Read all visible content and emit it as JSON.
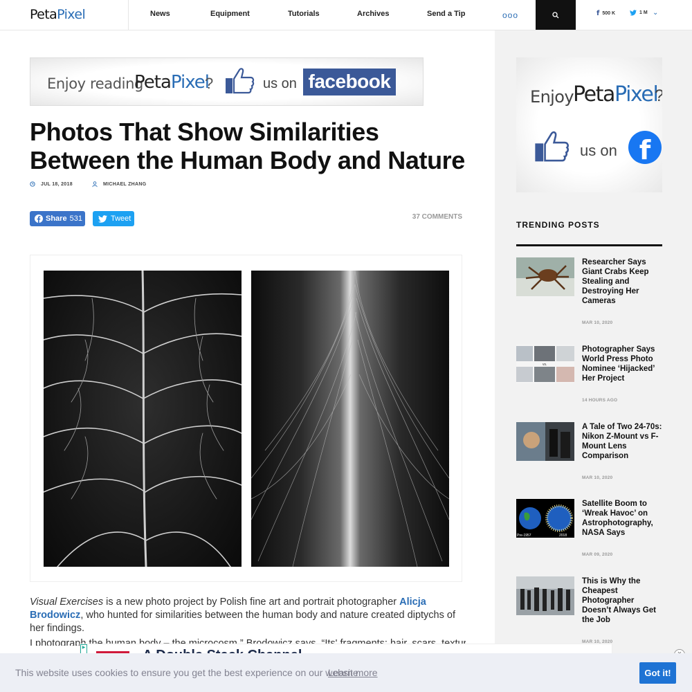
{
  "header": {
    "logo_part1": "Peta",
    "logo_part2": "Pixel",
    "nav": [
      "News",
      "Equipment",
      "Tutorials",
      "Archives",
      "Send a Tip"
    ],
    "more_label": "ooo",
    "facebook_count": "500 K",
    "twitter_count": "1 M",
    "icons": [
      "search-icon",
      "facebook-icon",
      "twitter-icon",
      "chevron-down-icon",
      "more-icon"
    ]
  },
  "banner_ad": {
    "text_enjoy": "Enjoy reading",
    "brand_part1": "Peta",
    "brand_part2": "Pixel",
    "question": "?",
    "text_uson": "us on",
    "facebook_label": "facebook"
  },
  "article": {
    "title": "Photos That Show Similarities Between the Human Body and Nature",
    "date": "JUL 18, 2018",
    "author": "MICHAEL ZHANG",
    "share_label": "Share",
    "share_count": "531",
    "tweet_label": "Tweet",
    "comments": "37 COMMENTS",
    "para1_italic": "Visual Exercises",
    "para1_a": " is a new photo project by Polish fine art and portrait photographer ",
    "para1_link": "Alicja Brodowicz",
    "para1_b": ", who hunted for similarities between the human body and nature created diptychs of her findings.",
    "para2": "I photograph the human body – the microcosm,” Brodowicz says. “Its' fragments: hair, scars, texture of"
  },
  "sidebar": {
    "ad_enjoy": "Enjoy",
    "ad_brand_part1": "Peta",
    "ad_brand_part2": "Pixel",
    "ad_question": "?",
    "ad_uson": "us on",
    "trending_title": "TRENDING POSTS",
    "posts": [
      {
        "title": "Researcher Says Giant Crabs Keep Stealing and Destroying Her Cameras",
        "date": "MAR 10, 2020"
      },
      {
        "title": "Photographer Says World Press Photo Nominee ‘Hijacked’ Her Project",
        "date": "14 HOURS AGO"
      },
      {
        "title": "A Tale of Two 24-70s: Nikon Z-Mount vs F-Mount Lens Comparison",
        "date": "MAR 10, 2020"
      },
      {
        "title": "Satellite Boom to ‘Wreak Havoc’ on Astrophotography, NASA Says",
        "date": "MAR 09, 2020"
      },
      {
        "title": "This is Why the Cheapest Photographer Doesn’t Always Get the Job",
        "date": "MAR 10, 2020"
      }
    ],
    "post2_thumb_label": "vs.",
    "post4_thumb_left": "Pre-1957",
    "post4_thumb_right": "2018"
  },
  "bottom_ad": {
    "text": "A  Double Stack Channel",
    "close": "×"
  },
  "cookie": {
    "message": "This website uses cookies to ensure you get the best experience on our website.",
    "learn_more": "Learn more",
    "button": "Got it!"
  },
  "colors": {
    "brand_blue": "#2a6db5",
    "facebook_blue": "#3b5998",
    "twitter_blue": "#1da1f2",
    "cookie_button": "#1e73d4"
  }
}
